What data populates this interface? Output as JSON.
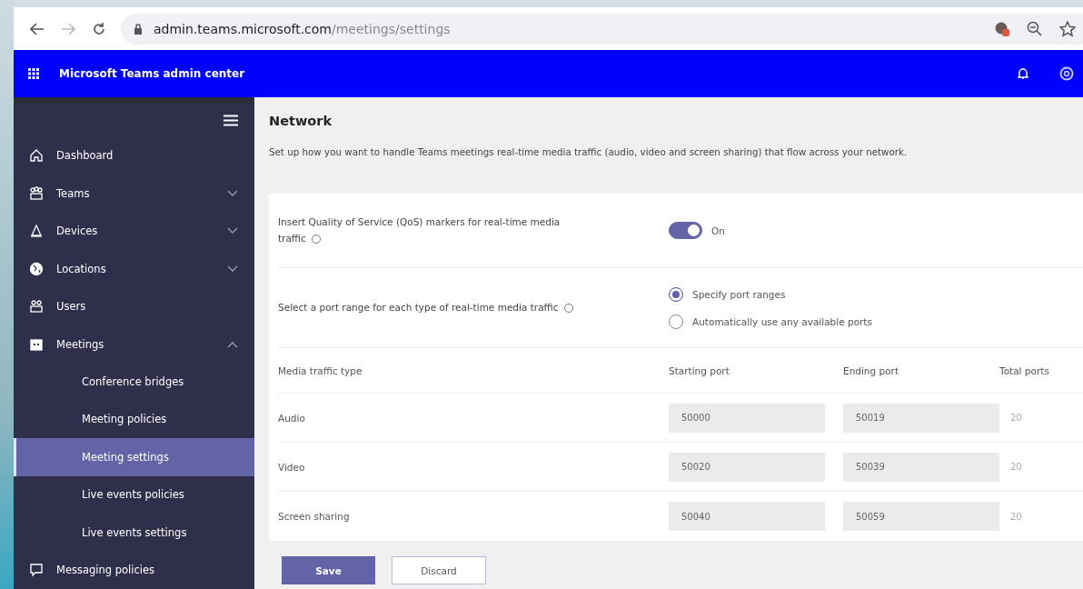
{
  "browser": {
    "url_host": "admin.teams.microsoft.com",
    "url_path": "/meetings/settings"
  },
  "header": {
    "title": "Microsoft Teams admin center"
  },
  "sidebar": {
    "items": [
      {
        "label": "Dashboard",
        "selected": false
      },
      {
        "label": "Teams",
        "selected": false,
        "expanded": false
      },
      {
        "label": "Devices",
        "selected": false,
        "expanded": false
      },
      {
        "label": "Locations",
        "selected": false,
        "expanded": false
      },
      {
        "label": "Users",
        "selected": false
      },
      {
        "label": "Meetings",
        "selected": false,
        "expanded": true,
        "children": [
          {
            "label": "Conference bridges",
            "selected": false
          },
          {
            "label": "Meeting policies",
            "selected": false
          },
          {
            "label": "Meeting settings",
            "selected": true
          },
          {
            "label": "Live events policies",
            "selected": false
          },
          {
            "label": "Live events settings",
            "selected": false
          }
        ]
      },
      {
        "label": "Messaging policies",
        "selected": false
      }
    ]
  },
  "section": {
    "title": "Network",
    "description": "Set up how you want to handle Teams meetings real-time media traffic (audio, video and screen sharing) that flow across your network.",
    "qos": {
      "label": "Insert Quality of Service (QoS) markers for real-time media traffic",
      "on": true,
      "state_label": "On"
    },
    "ports": {
      "label": "Select a port range for each type of real-time media traffic",
      "options": [
        {
          "label": "Specify port ranges",
          "selected": true
        },
        {
          "label": "Automatically use any available ports",
          "selected": false
        }
      ]
    },
    "table": {
      "columns": [
        "Media traffic type",
        "Starting port",
        "Ending port",
        "Total ports"
      ],
      "rows": [
        {
          "type": "Audio",
          "start": "50000",
          "end": "50019",
          "total": "20"
        },
        {
          "type": "Video",
          "start": "50020",
          "end": "50039",
          "total": "20"
        },
        {
          "type": "Screen sharing",
          "start": "50040",
          "end": "50059",
          "total": "20"
        }
      ]
    }
  },
  "buttons": [
    {
      "label": "Save",
      "kind": "primary"
    },
    {
      "label": "Discard",
      "kind": "secondary"
    }
  ]
}
